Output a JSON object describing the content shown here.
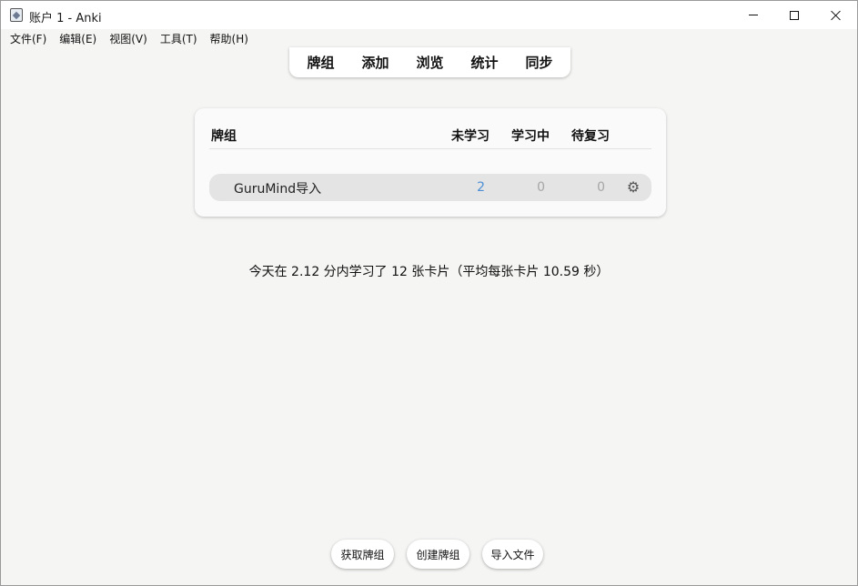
{
  "window": {
    "title": "账户 1 - Anki"
  },
  "menu": {
    "items": [
      "文件(F)",
      "编辑(E)",
      "视图(V)",
      "工具(T)",
      "帮助(H)"
    ]
  },
  "toolbar": {
    "items": [
      "牌组",
      "添加",
      "浏览",
      "统计",
      "同步"
    ]
  },
  "deck_table": {
    "headers": {
      "deck": "牌组",
      "new": "未学习",
      "learning": "学习中",
      "review": "待复习"
    },
    "rows": [
      {
        "name": "GuruMind导入",
        "new": "2",
        "learning": "0",
        "review": "0"
      }
    ]
  },
  "stats": {
    "text": "今天在 2.12 分内学习了 12 张卡片（平均每张卡片 10.59 秒）"
  },
  "bottom": {
    "get_shared": "获取牌组",
    "create_deck": "创建牌组",
    "import_file": "导入文件"
  },
  "colors": {
    "new_count": "#4c8fd6",
    "muted_count": "#a6a6a6",
    "background": "#f5f5f4"
  },
  "icons": {
    "app": "anki-app-icon",
    "deck_options": "gear-icon"
  }
}
